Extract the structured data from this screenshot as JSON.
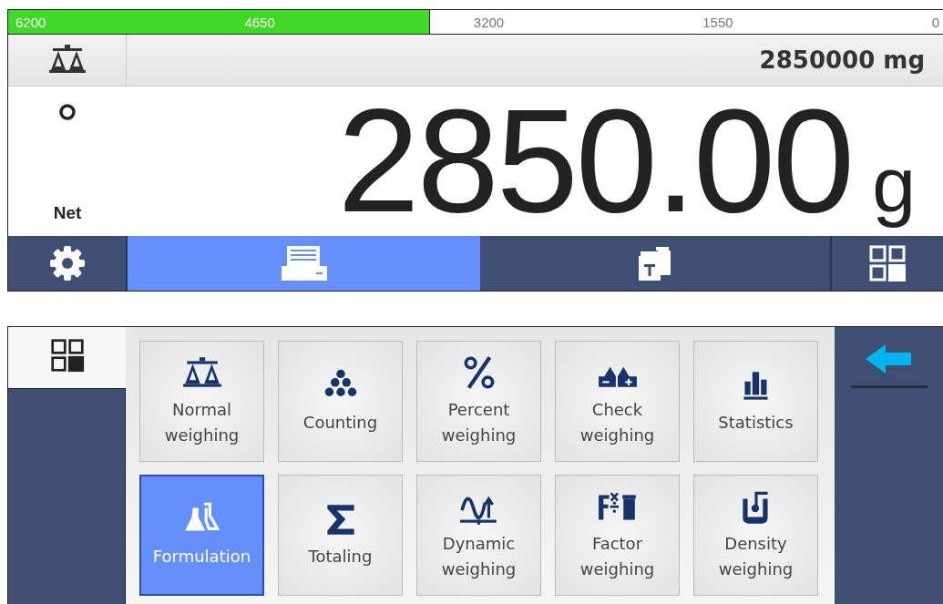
{
  "capacity_bar": {
    "level": 0.45,
    "ticks": [
      "6200",
      "4650",
      "3200",
      "1550",
      "0"
    ]
  },
  "display": {
    "secondary_reading": "2850000 mg",
    "net_label": "Net",
    "value": "2850.00",
    "unit": "g"
  },
  "toolbar": [
    {
      "kind": "settings",
      "selected": false
    },
    {
      "kind": "printer",
      "selected": true
    },
    {
      "kind": "tare",
      "selected": false
    },
    {
      "kind": "apps",
      "selected": false
    }
  ],
  "apps": [
    {
      "kind": "balance",
      "label": "Normal weighing",
      "selected": false
    },
    {
      "kind": "counting",
      "label": "Counting",
      "selected": false
    },
    {
      "kind": "percent",
      "label": "Percent weighing",
      "selected": false
    },
    {
      "kind": "check",
      "label": "Check weighing",
      "selected": false
    },
    {
      "kind": "statistics",
      "label": "Statistics",
      "selected": false
    },
    {
      "kind": "formulation",
      "label": "Formulation",
      "selected": true
    },
    {
      "kind": "sum",
      "label": "Totaling",
      "selected": false
    },
    {
      "kind": "dynamic",
      "label": "Dynamic weighing",
      "selected": false
    },
    {
      "kind": "factor",
      "label": "Factor weighing",
      "selected": false
    },
    {
      "kind": "density",
      "label": "Density weighing",
      "selected": false
    }
  ]
}
